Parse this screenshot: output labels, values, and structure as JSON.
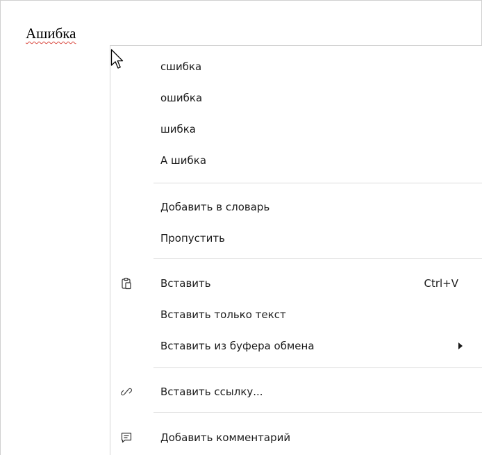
{
  "document": {
    "word": "Ашибка"
  },
  "menu": {
    "suggestions": [
      "сшибка",
      "ошибка",
      "шибка",
      "А шибка"
    ],
    "add_to_dictionary": "Добавить в словарь",
    "skip": "Пропустить",
    "paste": {
      "label": "Вставить",
      "shortcut": "Ctrl+V",
      "icon": "clipboard-icon"
    },
    "paste_text_only": "Вставить только текст",
    "paste_from_clipboard": {
      "label": "Вставить из буфера обмена",
      "icon": "submenu-arrow-icon"
    },
    "insert_link": {
      "label": "Вставить ссылку...",
      "icon": "link-icon"
    },
    "add_comment": {
      "label": "Добавить комментарий",
      "icon": "comment-icon"
    }
  },
  "colors": {
    "spellcheck_underline": "#d9463c",
    "menu_border": "#d4d4d4",
    "separator": "#dcdcdc"
  }
}
